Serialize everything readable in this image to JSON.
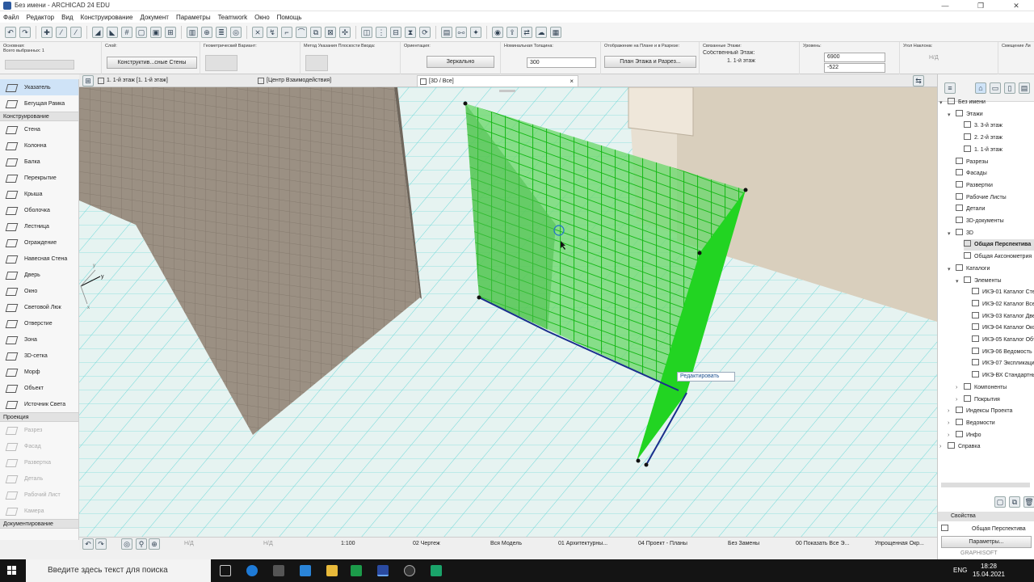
{
  "window": {
    "title": "Без имени - ARCHICAD 24 EDU",
    "controls": [
      "—",
      "❐",
      "✕"
    ]
  },
  "menu": [
    "Файл",
    "Редактор",
    "Вид",
    "Конструирование",
    "Документ",
    "Параметры",
    "Teamwork",
    "Окно",
    "Помощь"
  ],
  "infobox": {
    "main_label": "Основная:",
    "selected_count": "Всего выбранных: 1",
    "layer_label": "Слой:",
    "layer_value": "Конструктив...сные Стены",
    "geometry_label": "Геометрический Вариант:",
    "method_label": "Метод Указания Плоскости Ввода:",
    "orientation_label": "Ориентация:",
    "orientation_value": "Зеркально",
    "thickness_label": "Номинальная Толщина:",
    "thickness_value": "300",
    "floorplan_label": "Отображение на Плане и в Разрезе:",
    "floorplan_value": "План Этажа и Разрез...",
    "linked_label": "Связанные Этажи:",
    "home_story_label": "Собственный Этаж:",
    "home_story_value": "1. 1-й этаж",
    "levels_label": "Уровень:",
    "level_top": "6900",
    "level_bottom": "-522",
    "slant_label": "Угол Наклона:",
    "slant_value": "Н/Д",
    "offset_label": "Смещение Лин"
  },
  "tabs": [
    {
      "label": "1. 1-й этаж [1. 1-й этаж]"
    },
    {
      "label": "[Центр Взаимодействия]"
    },
    {
      "label": "[3D / Все]",
      "close": "×"
    }
  ],
  "toolbox": {
    "top": [
      {
        "label": "Указатель",
        "selected": true
      },
      {
        "label": "Бегущая Рамка"
      }
    ],
    "group_design": "Конструирование",
    "design": [
      "Стена",
      "Колонна",
      "Балка",
      "Перекрытие",
      "Крыша",
      "Оболочка",
      "Лестница",
      "Ограждение",
      "Навесная Стена",
      "Дверь",
      "Окно",
      "Световой Люк",
      "Отверстие",
      "Зона",
      "3D-сетка",
      "Морф",
      "Объект",
      "Источник Света"
    ],
    "group_view": "Проекция",
    "view": [
      "Разрез",
      "Фасад",
      "Развертка",
      "Деталь",
      "Рабочий Лист",
      "Камера"
    ],
    "group_doc": "Документирование"
  },
  "viewport": {
    "edit_popup": "Редактировать",
    "axis_y1": "y",
    "axis_y2": "y",
    "axis_x": "x"
  },
  "navigator": {
    "root": "Без имени",
    "stories_label": "Этажи",
    "stories": [
      "3. 3-й этаж",
      "2. 2-й этаж",
      "1. 1-й этаж"
    ],
    "folders": [
      "Разрезы",
      "Фасады",
      "Развертки",
      "Рабочие Листы",
      "Детали",
      "3D-документы"
    ],
    "node_3d": "3D",
    "items_3d": [
      "Общая Перспектива",
      "Общая Аксонометрия"
    ],
    "schedules_label": "Каталоги",
    "elements_label": "Элементы",
    "schedules": [
      "ИКЭ-01 Каталог Стен",
      "ИКЭ-02 Каталог Всех",
      "ИКЭ-03 Каталог Двер",
      "ИКЭ-04 Каталог Окон",
      "ИКЭ-05 Каталог Объ",
      "ИКЭ-06 Ведомость П",
      "ИКЭ-07 Экспликация",
      "ИКЭ-ВХ Стандартны"
    ],
    "components_label": "Компоненты",
    "coverings_label": "Покрытия",
    "bottom_items": [
      "Индексы Проекта",
      "Ведомости",
      "Инфо"
    ],
    "help_label": "Справка",
    "props_label": "Свойства",
    "props_value": "Общая Перспектива",
    "settings_button": "Параметры...",
    "brand": "GRAPHISOFT"
  },
  "statusbar": {
    "na1": "Н/Д",
    "na2": "Н/Д",
    "scale": "1:100",
    "drawing": "02 Чертеж",
    "model": "Вся Модель",
    "layers": "01 Архитектурны...",
    "penset": "04 Проект - Планы",
    "override": "Без Замены",
    "show": "00 Показать Все Э...",
    "simplified": "Упрощенная Окр..."
  },
  "taskbar": {
    "search_placeholder": "Введите здесь текст для поиска",
    "time": "18:28",
    "date": "15.04.2021",
    "lang": "ENG"
  }
}
